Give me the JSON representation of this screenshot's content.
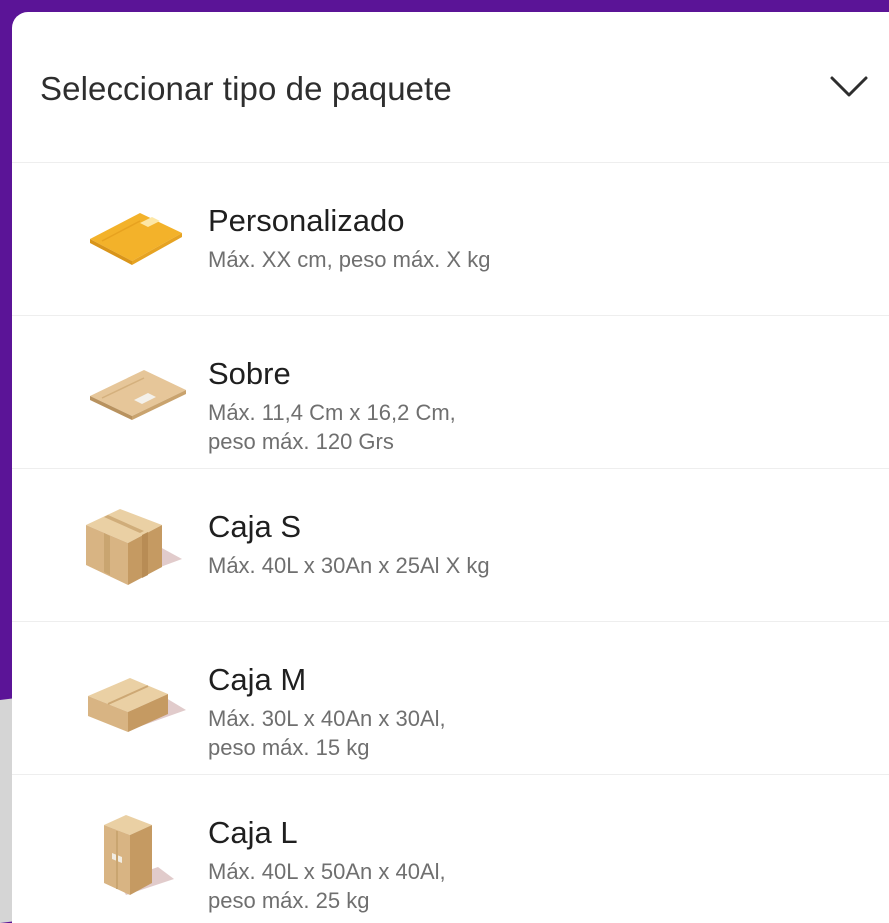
{
  "header": {
    "title": "Seleccionar tipo de paquete",
    "chevron_icon": "chevron-down-icon"
  },
  "options": [
    {
      "title": "Personalizado",
      "description": "Máx. XX cm, peso máx. X kg",
      "icon": "yellow-envelope-icon"
    },
    {
      "title": "Sobre",
      "description": "Máx. 11,4 Cm x 16,2 Cm,\npeso máx. 120 Grs",
      "icon": "envelope-icon"
    },
    {
      "title": "Caja S",
      "description": "Máx. 40L x 30An x 25Al X kg",
      "icon": "small-box-icon"
    },
    {
      "title": "Caja M",
      "description": "Máx. 30L x 40An x 30Al,\npeso máx. 15 kg",
      "icon": "medium-box-icon"
    },
    {
      "title": "Caja L",
      "description": "Máx. 40L x 50An x 40Al,\npeso máx. 25 kg",
      "icon": "large-box-icon"
    }
  ],
  "colors": {
    "background_purple": "#5b1497",
    "sheet": "#ffffff",
    "title_text": "#1f1f1f",
    "secondary_text": "#6f6f6f",
    "envelope_yellow": "#f5b82e",
    "cardboard": "#dcbb8c"
  }
}
